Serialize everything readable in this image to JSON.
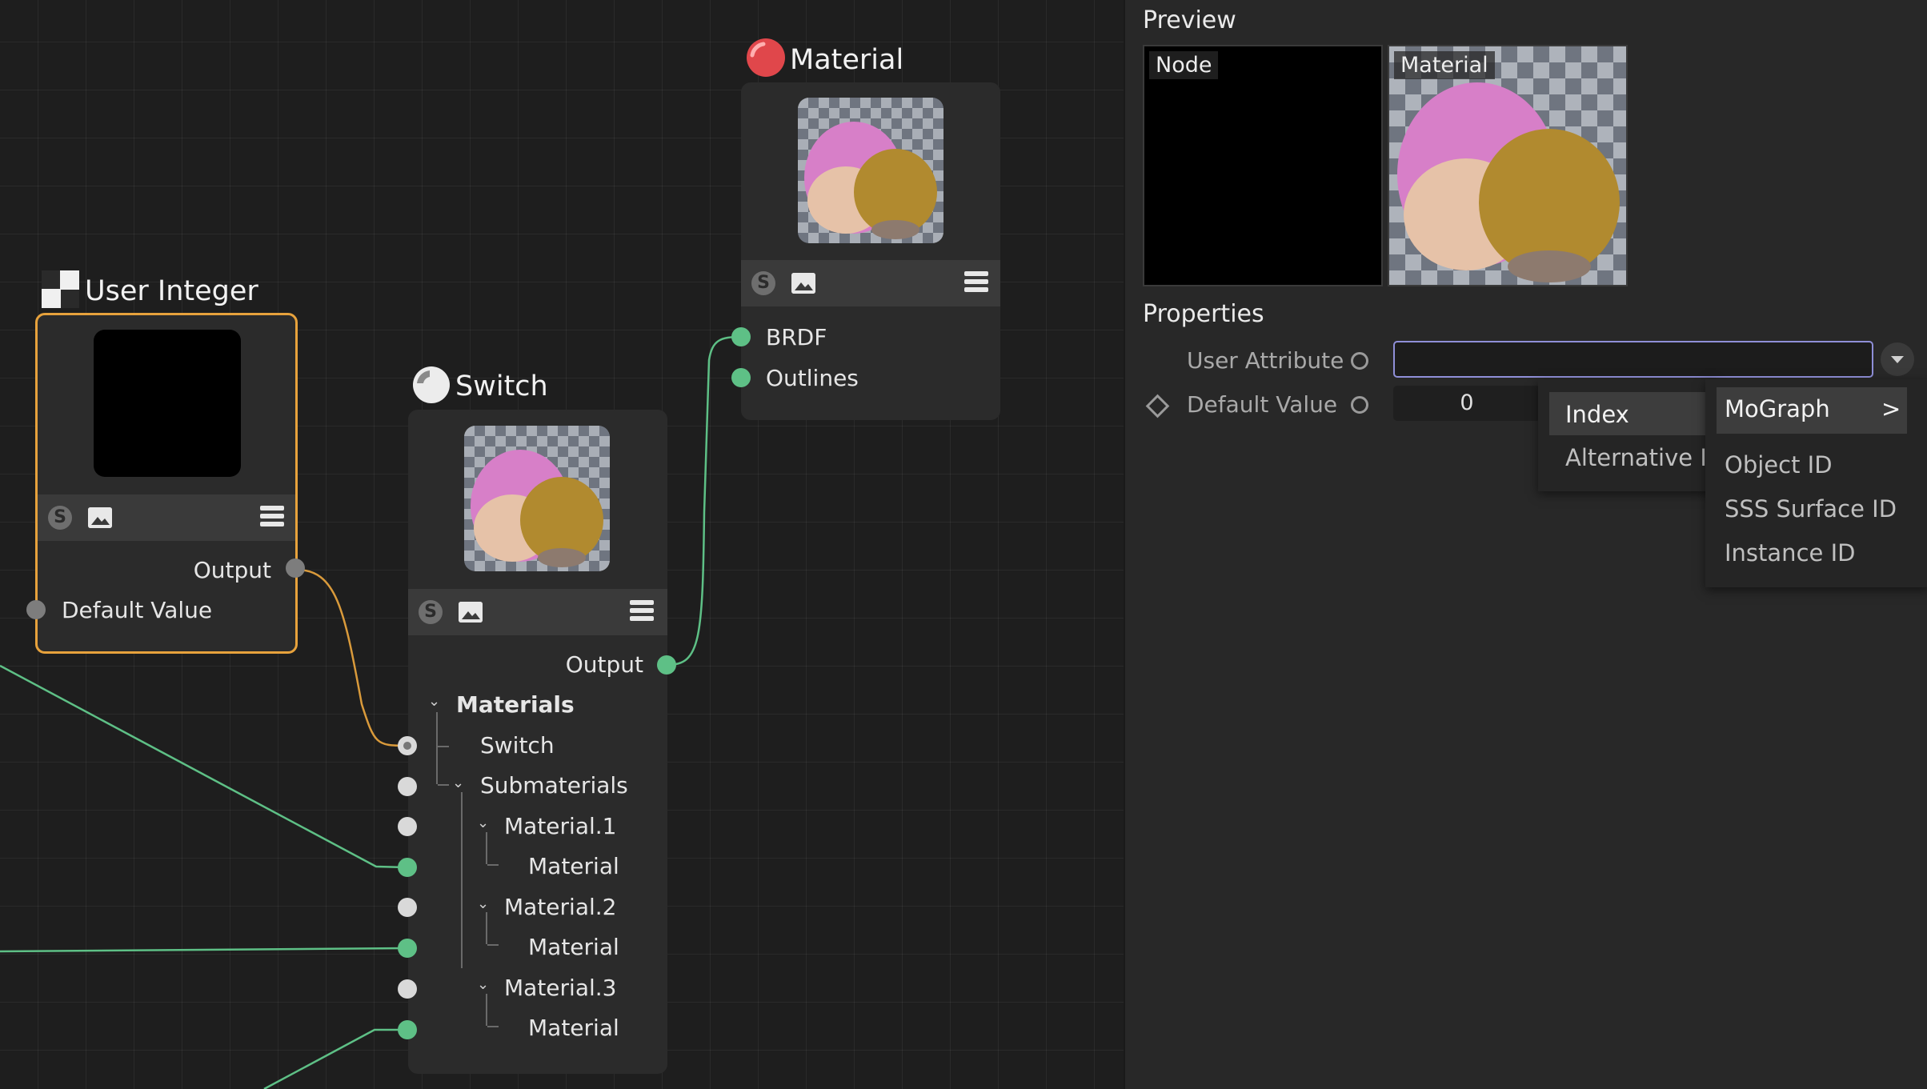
{
  "nodes": {
    "user_integer": {
      "title": "User Integer",
      "output": "Output",
      "input": "Default Value"
    },
    "switch": {
      "title": "Switch",
      "output": "Output",
      "tree": {
        "materials": "Materials",
        "switch": "Switch",
        "submaterials": "Submaterials",
        "material1": "Material.1",
        "material1_child": "Material",
        "material2": "Material.2",
        "material2_child": "Material",
        "material3": "Material.3",
        "material3_child": "Material"
      }
    },
    "material": {
      "title": "Material",
      "brdf": "BRDF",
      "outlines": "Outlines"
    }
  },
  "panel": {
    "preview_heading": "Preview",
    "preview_node_tag": "Node",
    "preview_material_tag": "Material",
    "properties_heading": "Properties",
    "user_attribute_label": "User Attribute",
    "user_attribute_value": "",
    "default_value_label": "Default Value",
    "default_value": "0"
  },
  "menu": {
    "index": "Index",
    "alternative_id": "Alternative ID",
    "mograph": "MoGraph",
    "submenu_arrow": ">",
    "object_id": "Object ID",
    "sss_surface_id": "SSS Surface ID",
    "instance_id": "Instance ID"
  },
  "colors": {
    "selection_border": "#e7a23c",
    "green_port": "#5ec086",
    "material_icon": "#e0474b",
    "field_focus": "#8f8fd8"
  }
}
